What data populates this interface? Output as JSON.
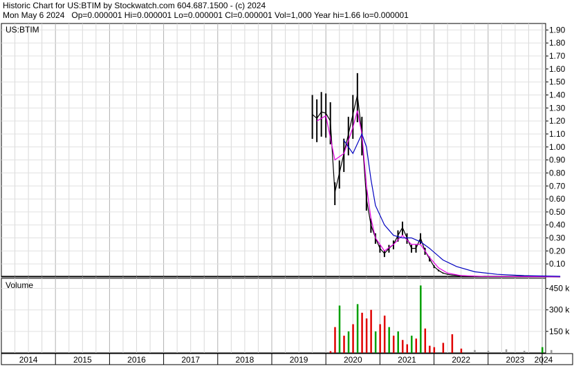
{
  "header": {
    "title_line": "Historic Chart for US:BTIM by Stockwatch.com 604.687.1500 - (c) 2024",
    "date": "Mon May  6 2024",
    "stats": "Op=0.000001   Hi=0.000001   Lo=0.000001   Cl=0.000001   Vol=1,000   Year hi=1.66   lo=0.000001"
  },
  "chart_data": [
    {
      "type": "candlestick",
      "label": "US:BTIM",
      "ylim": [
        0,
        1.95
      ],
      "y_ticks": [
        "1.90",
        "1.80",
        "1.70",
        "1.60",
        "1.50",
        "1.40",
        "1.30",
        "1.20",
        "1.10",
        "1.00",
        "0.90",
        "0.80",
        "0.70",
        "0.60",
        "0.50",
        "0.40",
        "0.30",
        "0.20",
        "0.10"
      ],
      "x_years": [
        "2014",
        "2015",
        "2016",
        "2017",
        "2018",
        "2019",
        "2020",
        "2021",
        "2022",
        "2023",
        "2024"
      ],
      "price": [
        [
          "2019-10",
          1.25
        ],
        [
          "2019-11",
          1.22
        ],
        [
          "2019-12",
          1.27
        ],
        [
          "2020-01",
          1.26
        ],
        [
          "2020-02",
          1.2
        ],
        [
          "2020-03",
          0.65
        ],
        [
          "2020-04",
          0.8
        ],
        [
          "2020-05",
          0.95
        ],
        [
          "2020-06",
          1.1
        ],
        [
          "2020-07",
          1.25
        ],
        [
          "2020-08",
          1.4
        ],
        [
          "2020-09",
          1.1
        ],
        [
          "2020-10",
          0.6
        ],
        [
          "2020-11",
          0.4
        ],
        [
          "2020-12",
          0.3
        ],
        [
          "2021-01",
          0.22
        ],
        [
          "2021-02",
          0.18
        ],
        [
          "2021-03",
          0.22
        ],
        [
          "2021-04",
          0.25
        ],
        [
          "2021-05",
          0.32
        ],
        [
          "2021-06",
          0.38
        ],
        [
          "2021-07",
          0.3
        ],
        [
          "2021-08",
          0.22
        ],
        [
          "2021-09",
          0.22
        ],
        [
          "2021-10",
          0.3
        ],
        [
          "2021-11",
          0.2
        ],
        [
          "2021-12",
          0.14
        ],
        [
          "2022-01",
          0.08
        ],
        [
          "2022-02",
          0.05
        ],
        [
          "2022-03",
          0.03
        ],
        [
          "2022-04",
          0.02
        ],
        [
          "2022-05",
          0.015
        ],
        [
          "2022-07",
          0.01
        ],
        [
          "2022-10",
          0.005
        ],
        [
          "2023-01",
          0.003
        ],
        [
          "2023-06",
          0.002
        ],
        [
          "2024-01",
          0.001
        ],
        [
          "2024-05",
          1e-06
        ]
      ],
      "ma_pink": [
        [
          "2019-11",
          1.2
        ],
        [
          "2020-01",
          1.24
        ],
        [
          "2020-03",
          0.9
        ],
        [
          "2020-05",
          0.95
        ],
        [
          "2020-07",
          1.15
        ],
        [
          "2020-08",
          1.28
        ],
        [
          "2020-09",
          1.1
        ],
        [
          "2020-10",
          0.7
        ],
        [
          "2020-11",
          0.45
        ],
        [
          "2020-12",
          0.3
        ],
        [
          "2021-02",
          0.2
        ],
        [
          "2021-04",
          0.25
        ],
        [
          "2021-06",
          0.32
        ],
        [
          "2021-08",
          0.25
        ],
        [
          "2021-10",
          0.25
        ],
        [
          "2021-12",
          0.15
        ],
        [
          "2022-02",
          0.07
        ],
        [
          "2022-04",
          0.03
        ],
        [
          "2022-07",
          0.01
        ],
        [
          "2022-12",
          0.004
        ],
        [
          "2024-05",
          0.001
        ]
      ],
      "ma_blue": [
        [
          "2020-05",
          1.05
        ],
        [
          "2020-07",
          0.95
        ],
        [
          "2020-09",
          1.1
        ],
        [
          "2020-10",
          1.0
        ],
        [
          "2020-11",
          0.75
        ],
        [
          "2020-12",
          0.55
        ],
        [
          "2021-02",
          0.4
        ],
        [
          "2021-04",
          0.32
        ],
        [
          "2021-06",
          0.3
        ],
        [
          "2021-08",
          0.3
        ],
        [
          "2021-10",
          0.27
        ],
        [
          "2021-12",
          0.22
        ],
        [
          "2022-03",
          0.13
        ],
        [
          "2022-06",
          0.08
        ],
        [
          "2022-10",
          0.04
        ],
        [
          "2023-03",
          0.02
        ],
        [
          "2023-09",
          0.01
        ],
        [
          "2024-05",
          0.005
        ]
      ]
    },
    {
      "type": "bar",
      "label": "Volume",
      "ylim": [
        0,
        520
      ],
      "y_ticks": [
        "450 k",
        "300 k",
        "150 k"
      ],
      "colors": {
        "up": "#00a000",
        "down": "#e00000",
        "flat": "#999999"
      },
      "bars": [
        [
          "2020-02",
          12,
          "red"
        ],
        [
          "2020-03",
          180,
          "red"
        ],
        [
          "2020-04",
          330,
          "green"
        ],
        [
          "2020-05",
          120,
          "red"
        ],
        [
          "2020-06",
          150,
          "green"
        ],
        [
          "2020-07",
          200,
          "red"
        ],
        [
          "2020-08",
          340,
          "green"
        ],
        [
          "2020-09",
          280,
          "red"
        ],
        [
          "2020-10",
          240,
          "red"
        ],
        [
          "2020-11",
          300,
          "red"
        ],
        [
          "2020-12",
          150,
          "green"
        ],
        [
          "2021-01",
          200,
          "red"
        ],
        [
          "2021-02",
          260,
          "red"
        ],
        [
          "2021-03",
          180,
          "green"
        ],
        [
          "2021-04",
          120,
          "red"
        ],
        [
          "2021-05",
          150,
          "green"
        ],
        [
          "2021-06",
          90,
          "red"
        ],
        [
          "2021-07",
          60,
          "red"
        ],
        [
          "2021-08",
          120,
          "green"
        ],
        [
          "2021-09",
          100,
          "red"
        ],
        [
          "2021-10",
          470,
          "green"
        ],
        [
          "2021-11",
          170,
          "red"
        ],
        [
          "2021-12",
          50,
          "red"
        ],
        [
          "2022-01",
          40,
          "red"
        ],
        [
          "2022-03",
          70,
          "red"
        ],
        [
          "2022-05",
          130,
          "red"
        ],
        [
          "2022-07",
          30,
          "red"
        ],
        [
          "2022-10",
          20,
          "flat"
        ],
        [
          "2023-01",
          15,
          "flat"
        ],
        [
          "2023-05",
          25,
          "flat"
        ],
        [
          "2023-09",
          15,
          "flat"
        ],
        [
          "2024-01",
          40,
          "green"
        ],
        [
          "2024-03",
          20,
          "flat"
        ]
      ]
    }
  ]
}
